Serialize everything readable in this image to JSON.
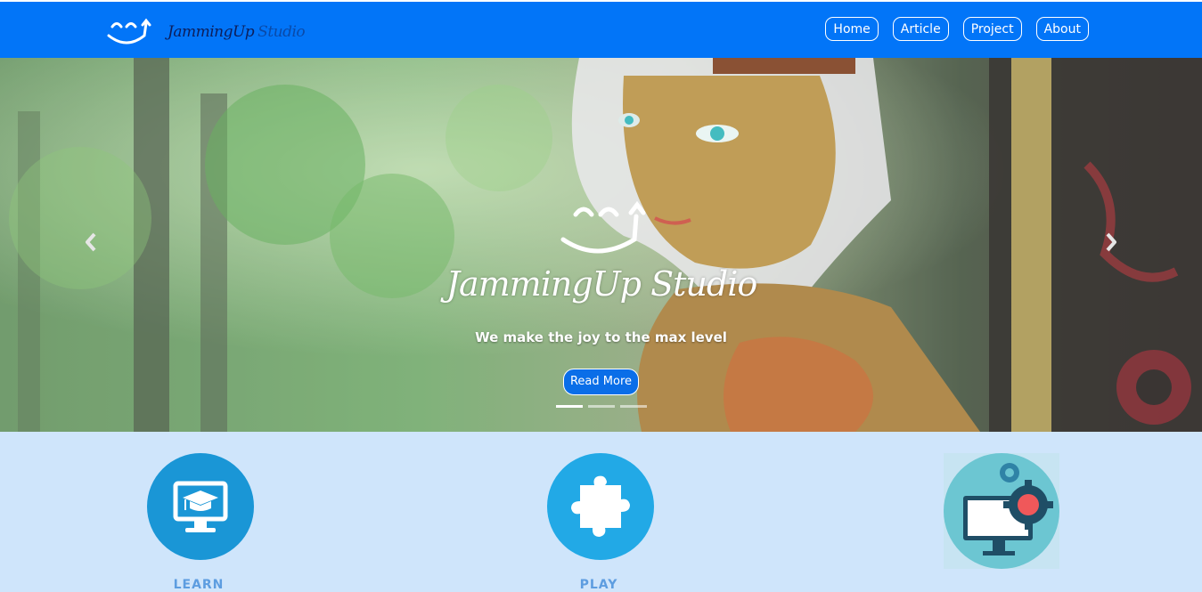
{
  "brand": {
    "name_main": "JammingUp",
    "name_studio": "Studio"
  },
  "nav": {
    "items": [
      {
        "label": "Home"
      },
      {
        "label": "Article"
      },
      {
        "label": "Project"
      },
      {
        "label": "About"
      }
    ]
  },
  "hero": {
    "title": "JammingUp Studio",
    "tagline": "We make the joy to the max level",
    "cta_label": "Read More",
    "prev_icon": "chevron-left-icon",
    "next_icon": "chevron-right-icon",
    "slides_count": 3,
    "active_slide": 1
  },
  "features": [
    {
      "label": "LEARN",
      "icon": "monitor-graduation-cap-icon"
    },
    {
      "label": "PLAY",
      "icon": "puzzle-piece-icon"
    },
    {
      "label": "",
      "icon": "monitor-gears-icon"
    }
  ],
  "colors": {
    "navbar": "#0275f8",
    "features_bg": "#cfe5fb",
    "accent": "#0a6ee8",
    "feature_label": "#5d9de0"
  }
}
